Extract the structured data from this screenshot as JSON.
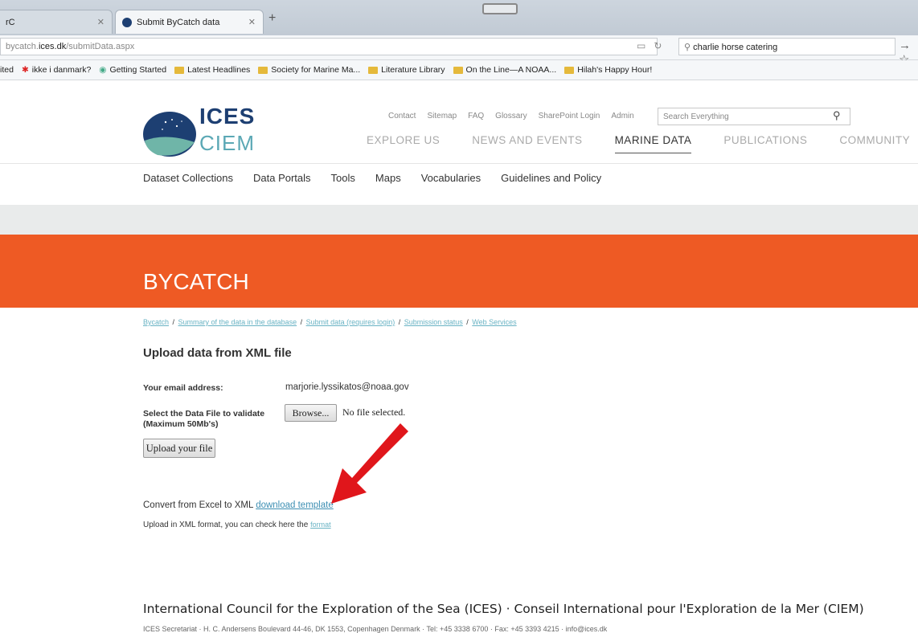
{
  "browser": {
    "tab_left": "rC",
    "tab_active": "Submit ByCatch data",
    "url_prefix": "bycatch.",
    "url_domain": "ices.dk",
    "url_path": "/submitData.aspx",
    "search_value": "charlie horse catering",
    "bookmarks": [
      "ited",
      "ikke i danmark?",
      "Getting Started",
      "Latest Headlines",
      "Society for Marine Ma...",
      "Literature Library",
      "On the Line—A NOAA...",
      "Hilah's Happy Hour!"
    ]
  },
  "header": {
    "logo_top": "ICES",
    "logo_bottom": "CIEM",
    "top_links": [
      "Contact",
      "Sitemap",
      "FAQ",
      "Glossary",
      "SharePoint Login",
      "Admin"
    ],
    "search_placeholder": "Search Everything",
    "main_nav": [
      "EXPLORE US",
      "NEWS AND EVENTS",
      "MARINE DATA",
      "PUBLICATIONS",
      "COMMUNITY"
    ],
    "sub_nav": [
      "Dataset Collections",
      "Data Portals",
      "Tools",
      "Maps",
      "Vocabularies",
      "Guidelines and Policy"
    ]
  },
  "page": {
    "banner_title": "BYCATCH",
    "breadcrumb": [
      "Bycatch",
      "Summary of the data in the database",
      "Submit data (requires login)",
      "Submission status",
      "Web Services"
    ],
    "heading": "Upload data from XML file",
    "email_label": "Your email address:",
    "email_value": "marjorie.lyssikatos@noaa.gov",
    "select_label_1": "Select the Data File to validate",
    "select_label_2": "(Maximum 50Mb's)",
    "browse_label": "Browse...",
    "no_file": "No file selected.",
    "upload_button": "Upload your file",
    "convert_text": "Convert from Excel to XML ",
    "convert_link": "download template",
    "xml_text": "Upload in XML format, you can check here the ",
    "xml_link": "format"
  },
  "footer": {
    "title": "International Council for the Exploration of the Sea (ICES) · Conseil International pour l'Exploration de la Mer (CIEM)",
    "address": "ICES Secretariat · H. C. Andersens Boulevard 44-46, DK 1553, Copenhagen Denmark · Tel: +45 3338 6700 · Fax: +45 3393 4215 · info@ices.dk"
  },
  "colors": {
    "banner": "#ee5a24",
    "link": "#3d8fb3",
    "annotation_arrow": "#e0161b"
  }
}
